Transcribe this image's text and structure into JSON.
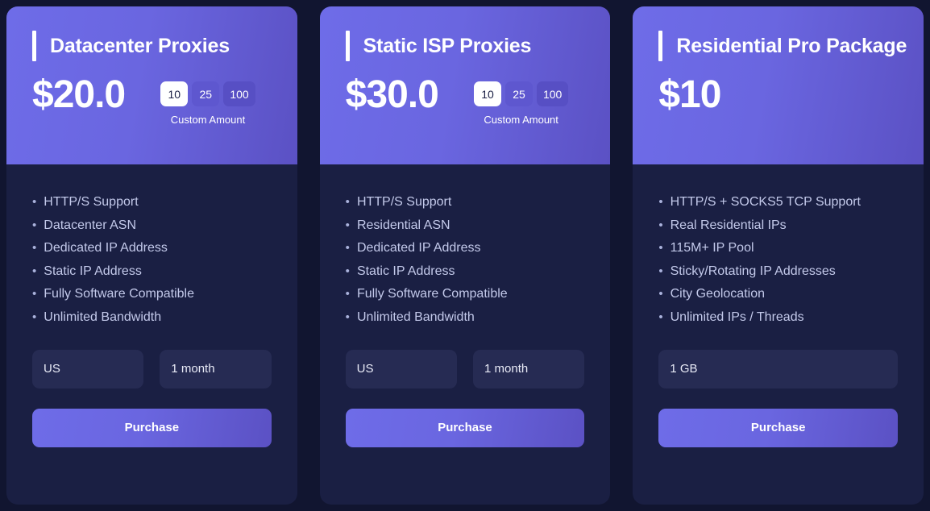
{
  "page": {
    "background_color": "#111530",
    "card_background": "#1a1f43",
    "accent_gradient_start": "#6e6ce8",
    "accent_gradient_end": "#5b51c4",
    "select_background": "#262b53",
    "feature_text_color": "#c3c9ea"
  },
  "cards": [
    {
      "title": "Datacenter Proxies",
      "price": "$20.0",
      "quantity": {
        "options": [
          "10",
          "25",
          "100"
        ],
        "selected": "10",
        "label": "Custom Amount"
      },
      "features": [
        "HTTP/S Support",
        "Datacenter ASN",
        "Dedicated IP Address",
        "Static IP Address",
        "Fully Software Compatible",
        "Unlimited Bandwidth"
      ],
      "selects": [
        {
          "name": "region",
          "value": "US"
        },
        {
          "name": "duration",
          "value": "1 month"
        }
      ],
      "purchase_label": "Purchase"
    },
    {
      "title": "Static ISP Proxies",
      "price": "$30.0",
      "quantity": {
        "options": [
          "10",
          "25",
          "100"
        ],
        "selected": "10",
        "label": "Custom Amount"
      },
      "features": [
        "HTTP/S Support",
        "Residential ASN",
        "Dedicated IP Address",
        "Static IP Address",
        "Fully Software Compatible",
        "Unlimited Bandwidth"
      ],
      "selects": [
        {
          "name": "region",
          "value": "US"
        },
        {
          "name": "duration",
          "value": "1 month"
        }
      ],
      "purchase_label": "Purchase"
    },
    {
      "title": "Residential Pro Package",
      "price": "$10",
      "quantity": null,
      "features": [
        "HTTP/S + SOCKS5 TCP Support",
        "Real Residential IPs",
        "115M+ IP Pool",
        "Sticky/Rotating IP Addresses",
        "City Geolocation",
        "Unlimited IPs / Threads"
      ],
      "selects": [
        {
          "name": "bandwidth",
          "value": "1 GB"
        }
      ],
      "purchase_label": "Purchase"
    }
  ],
  "bullet_glyph": "•"
}
